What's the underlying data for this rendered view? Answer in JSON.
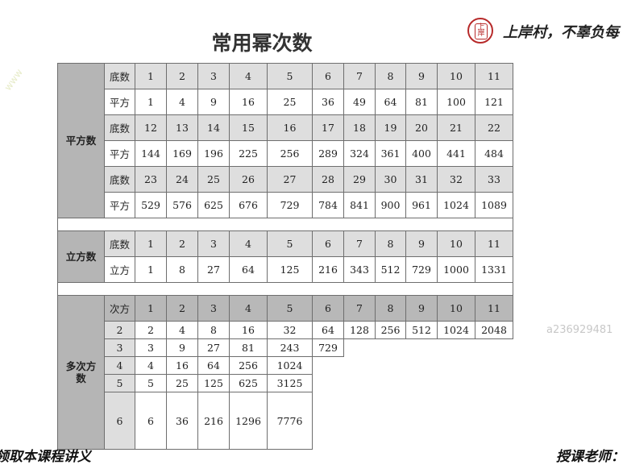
{
  "title": "常用幂次数",
  "brand": {
    "slogan": "上岸村，不辜负每",
    "logo_text": "上岸村"
  },
  "footer": {
    "left": "领取本课程讲义",
    "right": "授课老师："
  },
  "watermark": "a236929481",
  "faint_mark": "www",
  "squares": {
    "label": "平方数",
    "rows": [
      {
        "label": "底数",
        "values": [
          "1",
          "2",
          "3",
          "4",
          "5",
          "6",
          "7",
          "8",
          "9",
          "10",
          "11"
        ]
      },
      {
        "label": "平方",
        "values": [
          "1",
          "4",
          "9",
          "16",
          "25",
          "36",
          "49",
          "64",
          "81",
          "100",
          "121"
        ]
      },
      {
        "label": "底数",
        "values": [
          "12",
          "13",
          "14",
          "15",
          "16",
          "17",
          "18",
          "19",
          "20",
          "21",
          "22"
        ]
      },
      {
        "label": "平方",
        "values": [
          "144",
          "169",
          "196",
          "225",
          "256",
          "289",
          "324",
          "361",
          "400",
          "441",
          "484"
        ]
      },
      {
        "label": "底数",
        "values": [
          "23",
          "24",
          "25",
          "26",
          "27",
          "28",
          "29",
          "30",
          "31",
          "32",
          "33"
        ]
      },
      {
        "label": "平方",
        "values": [
          "529",
          "576",
          "625",
          "676",
          "729",
          "784",
          "841",
          "900",
          "961",
          "1024",
          "1089"
        ]
      }
    ]
  },
  "cubes": {
    "label": "立方数",
    "rows": [
      {
        "label": "底数",
        "values": [
          "1",
          "2",
          "3",
          "4",
          "5",
          "6",
          "7",
          "8",
          "9",
          "10",
          "11"
        ]
      },
      {
        "label": "立方",
        "values": [
          "1",
          "8",
          "27",
          "64",
          "125",
          "216",
          "343",
          "512",
          "729",
          "1000",
          "1331"
        ]
      }
    ]
  },
  "powers": {
    "label": "多次方数",
    "header": {
      "label": "次方",
      "values": [
        "1",
        "2",
        "3",
        "4",
        "5",
        "6",
        "7",
        "8",
        "9",
        "10",
        "11"
      ]
    },
    "rows": [
      {
        "label": "2",
        "values": [
          "2",
          "4",
          "8",
          "16",
          "32",
          "64",
          "128",
          "256",
          "512",
          "1024",
          "2048"
        ]
      },
      {
        "label": "3",
        "values": [
          "3",
          "9",
          "27",
          "81",
          "243",
          "729"
        ]
      },
      {
        "label": "4",
        "values": [
          "4",
          "16",
          "64",
          "256",
          "1024"
        ]
      },
      {
        "label": "5",
        "values": [
          "5",
          "25",
          "125",
          "625",
          "3125"
        ]
      },
      {
        "label": "6",
        "values": [
          "6",
          "36",
          "216",
          "1296",
          "7776"
        ]
      }
    ]
  }
}
